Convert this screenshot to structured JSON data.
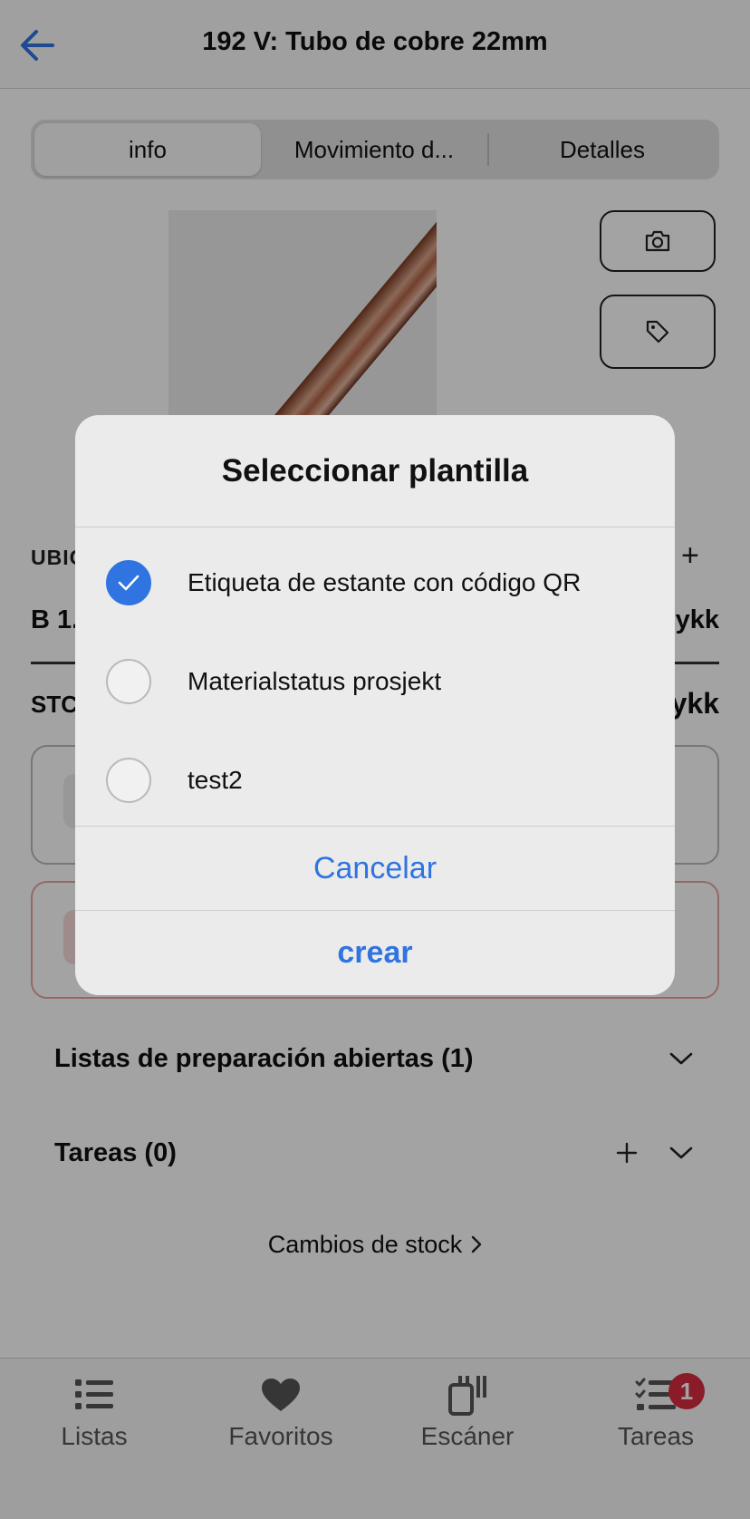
{
  "header": {
    "title": "192 V: Tubo de cobre 22mm",
    "back_icon": "arrow-left-icon"
  },
  "tabs": [
    {
      "label": "info",
      "active": true
    },
    {
      "label": "Movimiento d...",
      "active": false
    },
    {
      "label": "Detalles",
      "active": false
    }
  ],
  "side_buttons": {
    "camera_icon": "camera-icon",
    "tag_icon": "tag-icon"
  },
  "location": {
    "section_label": "UBIC",
    "value": "B 1.",
    "unit": "ykk"
  },
  "stock": {
    "section_label": "STC",
    "unit": "ykk"
  },
  "sections": {
    "listas": "Listas de preparación abiertas (1)",
    "tareas": "Tareas (0)",
    "stock_changes": "Cambios de stock"
  },
  "tabbar": [
    {
      "label": "Listas",
      "icon": "list-icon"
    },
    {
      "label": "Favoritos",
      "icon": "heart-icon"
    },
    {
      "label": "Escáner",
      "icon": "scanner-icon"
    },
    {
      "label": "Tareas",
      "icon": "tasks-icon",
      "badge": "1"
    }
  ],
  "dialog": {
    "title": "Seleccionar plantilla",
    "options": [
      {
        "label": "Etiqueta de estante con código QR",
        "selected": true
      },
      {
        "label": "Materialstatus prosjekt",
        "selected": false
      },
      {
        "label": "test2",
        "selected": false
      }
    ],
    "cancel_label": "Cancelar",
    "create_label": "crear"
  },
  "colors": {
    "accent": "#2f74e0",
    "badge": "#d62d3f",
    "overlay": "rgba(0,0,0,0.36)"
  }
}
